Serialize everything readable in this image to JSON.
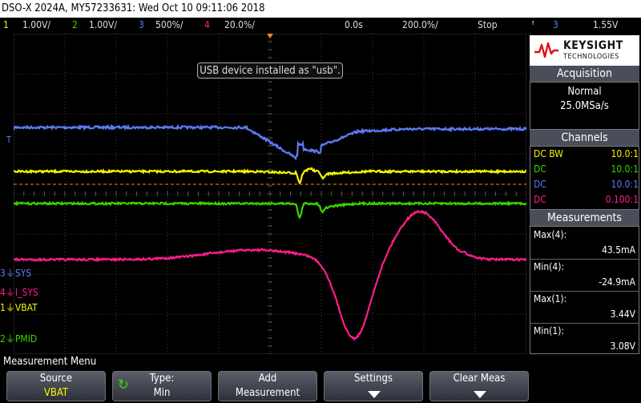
{
  "title_bar": "DSO-X 2024A, MY57233631: Wed Oct 10 09:11:06 2018",
  "status": {
    "ch1_num": "1",
    "ch1_scale": "1.00V/",
    "ch2_num": "2",
    "ch2_scale": "1.00V/",
    "ch3_num": "3",
    "ch3_scale": "500%/",
    "ch4_num": "4",
    "ch4_scale": "20.0%/",
    "time_delay": "0.0s",
    "time_scale": "200.0%/",
    "run_state": "Stop",
    "trigger_symbol": "ᶠ",
    "trigger_channel": "3",
    "trigger_level": "1.55V"
  },
  "tooltip": "USB device installed as \"usb\".",
  "brand": {
    "name": "KEYSIGHT",
    "sub": "TECHNOLOGIES"
  },
  "acquisition": {
    "header": "Acquisition",
    "mode": "Normal",
    "rate": "25.0MSa/s"
  },
  "channels": {
    "header": "Channels",
    "rows": [
      {
        "coupling": "DC BW",
        "probe": "10.0:1",
        "color": "#f5f500"
      },
      {
        "coupling": "DC",
        "probe": "10.0:1",
        "color": "#3dd400"
      },
      {
        "coupling": "DC",
        "probe": "10.0:1",
        "color": "#5b7cf5"
      },
      {
        "coupling": "DC",
        "probe": "0.100:1",
        "color": "#ff1d8e"
      }
    ]
  },
  "measurements": {
    "header": "Measurements",
    "items": [
      {
        "label": "Max(4):",
        "value": "43.5mA"
      },
      {
        "label": "Min(4):",
        "value": "-24.9mA"
      },
      {
        "label": "Max(1):",
        "value": "3.44V"
      },
      {
        "label": "Min(1):",
        "value": "3.08V"
      }
    ]
  },
  "waveform_labels": [
    {
      "num": "3",
      "text": "SYS",
      "color": "#5b7cf5"
    },
    {
      "num": "4",
      "text": "I_SYS",
      "color": "#ff1d8e"
    },
    {
      "num": "1",
      "text": "VBAT",
      "color": "#f5f500"
    },
    {
      "num": "2",
      "text": "PMID",
      "color": "#3dd400"
    }
  ],
  "trigger_marker": "T",
  "menu": {
    "title": "Measurement Menu",
    "softkeys": [
      {
        "line1": "Source",
        "line2": "VBAT"
      },
      {
        "line1": "Type:",
        "line2": "Min"
      },
      {
        "line1": "Add",
        "line2": "Measurement"
      },
      {
        "line1": "Settings",
        "line2": ""
      },
      {
        "line1": "Clear Meas",
        "line2": ""
      }
    ]
  },
  "colors": {
    "ch1": "#f5f500",
    "ch2": "#3dd400",
    "ch3": "#5b7cf5",
    "ch4": "#ff1d8e",
    "trigger_marker": "#f08c1e",
    "grid": "#3c3c3c"
  }
}
